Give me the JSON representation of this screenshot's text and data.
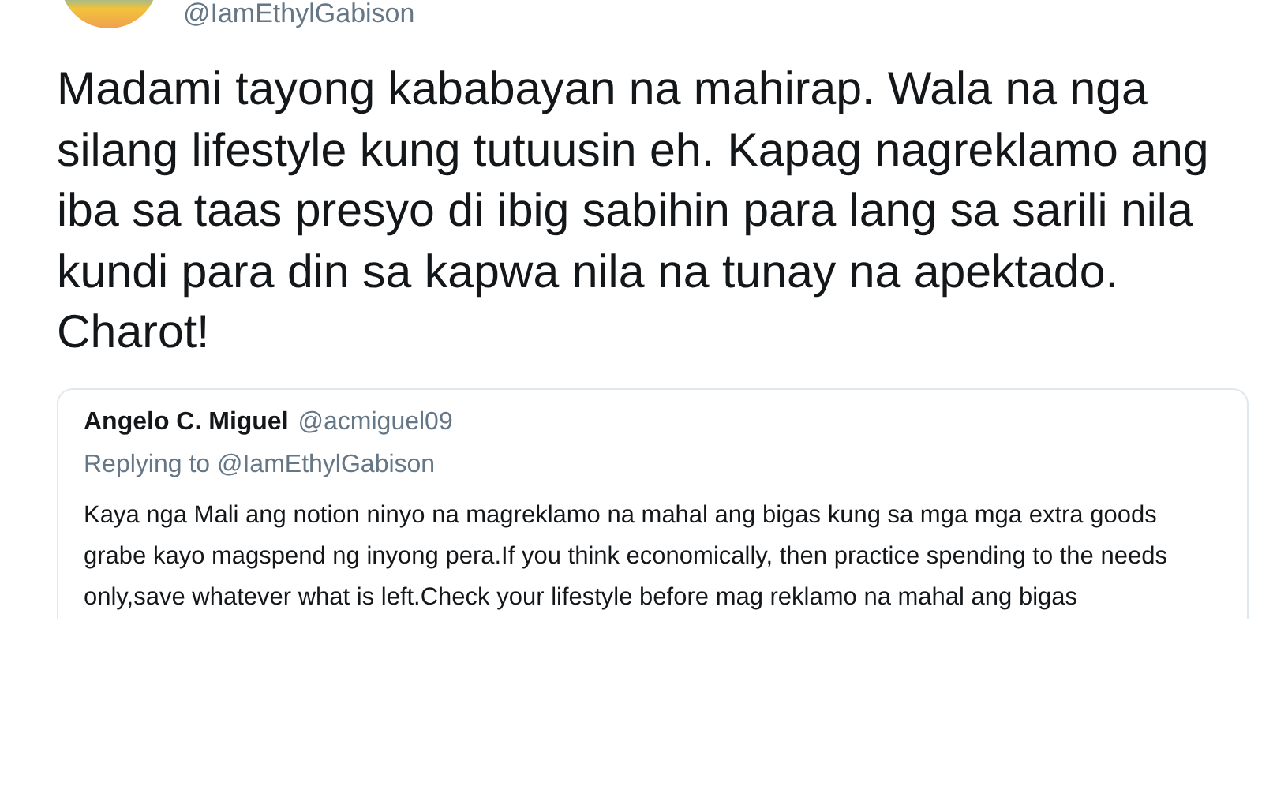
{
  "author": {
    "handle": "@IamEthylGabison"
  },
  "tweet_text": "Madami tayong kababayan na mahirap. Wala na nga silang lifestyle kung tutuusin eh. Kapag nagreklamo ang iba sa taas presyo di ibig sabihin para lang sa sarili nila kundi para din sa kapwa nila na tunay na apektado. Charot!",
  "quoted_tweet": {
    "name": "Angelo C. Miguel",
    "handle": "@acmiguel09",
    "replying_to": "Replying to @IamEthylGabison",
    "text": "Kaya nga Mali ang notion ninyo na magreklamo na mahal ang bigas kung sa mga mga extra goods grabe kayo magspend ng inyong pera.If you think economically, then practice spending to the needs only,save whatever what is left.Check your lifestyle before mag reklamo na mahal ang bigas"
  }
}
